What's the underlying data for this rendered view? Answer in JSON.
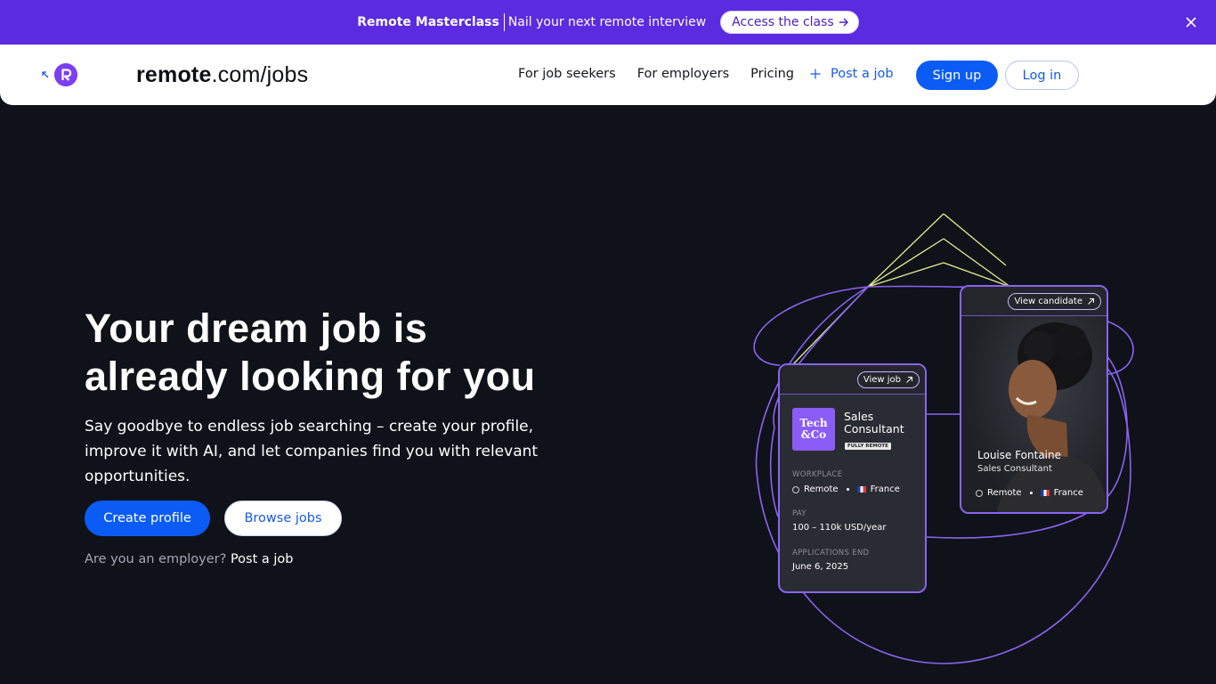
{
  "announcement": {
    "title": "Remote Masterclass",
    "text": "Nail your next remote interview",
    "cta": "Access the class",
    "close_icon": "close-icon"
  },
  "nav": {
    "brand_bold": "remote",
    "brand_rest": ".com/jobs",
    "links": [
      "For job seekers",
      "For employers",
      "Pricing"
    ],
    "post_job": "Post a job",
    "signup": "Sign up",
    "login": "Log in"
  },
  "hero": {
    "title_line1": "Your dream job is",
    "title_line2": "already looking for you",
    "subtitle": "Say goodbye to endless job searching – create your profile, improve it with AI, and let companies find you with relevant opportunities.",
    "create_profile": "Create profile",
    "browse_jobs": "Browse jobs",
    "employer_question": "Are you an employer?",
    "employer_link": "Post a job"
  },
  "job_card": {
    "view_button": "View job",
    "company_line1": "Tech",
    "company_line2": "&Co",
    "role_line1": "Sales",
    "role_line2": "Consultant",
    "badge": "FULLY REMOTE",
    "workplace_label": "WORKPLACE",
    "workplace_type": "Remote",
    "workplace_country": "France",
    "pay_label": "PAY",
    "pay_value": "100 – 110k USD/year",
    "applications_label": "APPLICATIONS END",
    "applications_value": "June 6, 2025"
  },
  "candidate_card": {
    "view_button": "View candidate",
    "name": "Louise Fontaine",
    "role": "Sales Consultant",
    "location_type": "Remote",
    "country": "France"
  },
  "colors": {
    "announce_bg": "#5b2be0",
    "primary": "#0b5cf5",
    "page_bg": "#0f1219",
    "accent_purple": "#8a63f0"
  }
}
